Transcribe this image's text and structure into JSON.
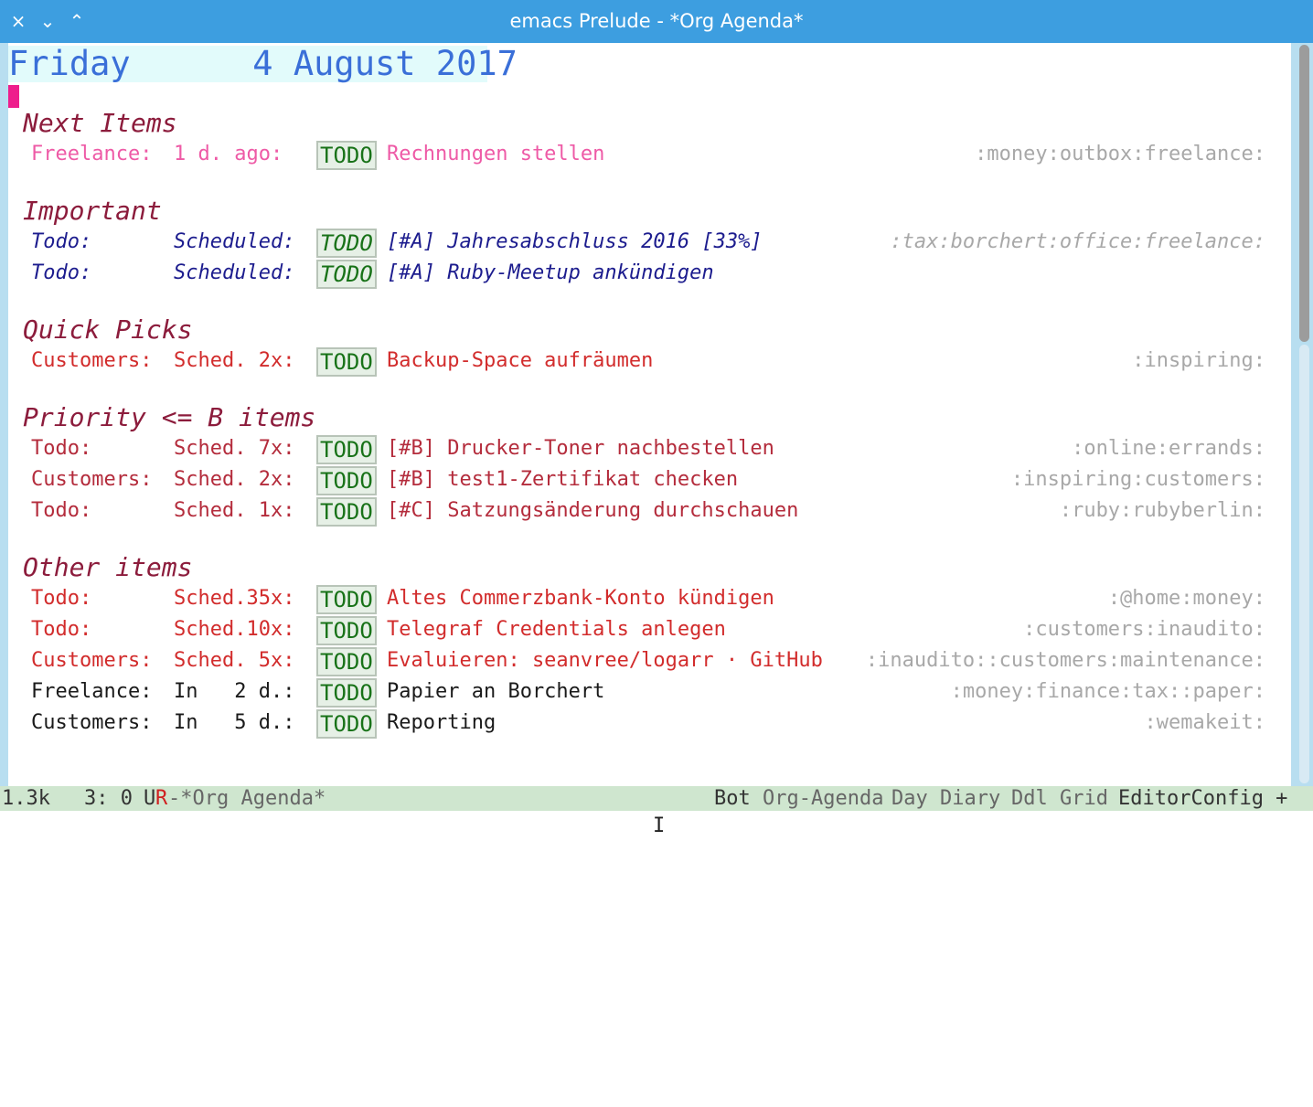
{
  "window": {
    "title": "emacs Prelude - *Org Agenda*",
    "buttons": [
      "×",
      "⌄",
      "⌃"
    ]
  },
  "date_header": "Friday      4 August 2017",
  "sections": [
    {
      "title": "Next Items",
      "rows": [
        {
          "category": "Freelance:",
          "sched": "1 d. ago:",
          "todo": "TODO",
          "title": "Rechnungen stellen",
          "tags": ":money:outbox:freelance:",
          "style": "pink"
        }
      ]
    },
    {
      "title": "Important",
      "rows": [
        {
          "category": "Todo:",
          "sched": "Scheduled:",
          "todo": "TODO",
          "title": "[#A] Jahresabschluss 2016 [33%]",
          "tags": ":tax:borchert:office:freelance:",
          "style": "navy"
        },
        {
          "category": "Todo:",
          "sched": "Scheduled:",
          "todo": "TODO",
          "title": "[#A] Ruby-Meetup ankündigen",
          "tags": "",
          "style": "navy"
        }
      ]
    },
    {
      "title": "Quick Picks",
      "rows": [
        {
          "category": "Customers:",
          "sched": "Sched. 2x:",
          "todo": "TODO",
          "title": "Backup-Space aufräumen",
          "tags": ":inspiring:",
          "style": "red"
        }
      ]
    },
    {
      "title": "Priority <= B items",
      "rows": [
        {
          "category": "Todo:",
          "sched": "Sched. 7x:",
          "todo": "TODO",
          "title": "[#B] Drucker-Toner nachbestellen",
          "tags": ":online:errands:",
          "style": "crimson"
        },
        {
          "category": "Customers:",
          "sched": "Sched. 2x:",
          "todo": "TODO",
          "title": "[#B] test1-Zertifikat checken",
          "tags": ":inspiring:customers:",
          "style": "crimson"
        },
        {
          "category": "Todo:",
          "sched": "Sched. 1x:",
          "todo": "TODO",
          "title": "[#C] Satzungsänderung durchschauen",
          "tags": ":ruby:rubyberlin:",
          "style": "crimson"
        }
      ]
    },
    {
      "title": "Other items",
      "rows": [
        {
          "category": "Todo:",
          "sched": "Sched.35x:",
          "todo": "TODO",
          "title": "Altes Commerzbank-Konto kündigen",
          "tags": ":@home:money:",
          "style": "red"
        },
        {
          "category": "Todo:",
          "sched": "Sched.10x:",
          "todo": "TODO",
          "title": "Telegraf Credentials anlegen",
          "tags": ":customers:inaudito:",
          "style": "red"
        },
        {
          "category": "Customers:",
          "sched": "Sched. 5x:",
          "todo": "TODO",
          "title": "Evaluieren: seanvree/logarr · GitHub",
          "tags": ":inaudito::customers:maintenance:",
          "style": "red"
        },
        {
          "category": "Freelance:",
          "sched": "In   2 d.:",
          "todo": "TODO",
          "title": "Papier an Borchert",
          "tags": ":money:finance:tax::paper:",
          "style": "black"
        },
        {
          "category": "Customers:",
          "sched": "In   5 d.:",
          "todo": "TODO",
          "title": "Reporting",
          "tags": ":wemakeit:",
          "style": "black"
        }
      ]
    }
  ],
  "modeline": {
    "size": "1.3k",
    "position": "3: 0",
    "state_u": "U",
    "state_r": "R",
    "buffer": "-*Org Agenda*",
    "bot": "Bot",
    "modes": [
      "Org-Agenda",
      "Day",
      "Diary",
      "Ddl",
      "Grid"
    ],
    "editorconfig": "EditorConfig +"
  },
  "colors": {
    "titlebar": "#3d9ee0",
    "date_header_bg": "#e2fbfb",
    "date_header_fg": "#3a6fd8",
    "section_title": "#8c1c3c",
    "todo_fg": "#187218",
    "cursor": "#ee1e8c",
    "modeline_bg": "#cfe6cf"
  }
}
